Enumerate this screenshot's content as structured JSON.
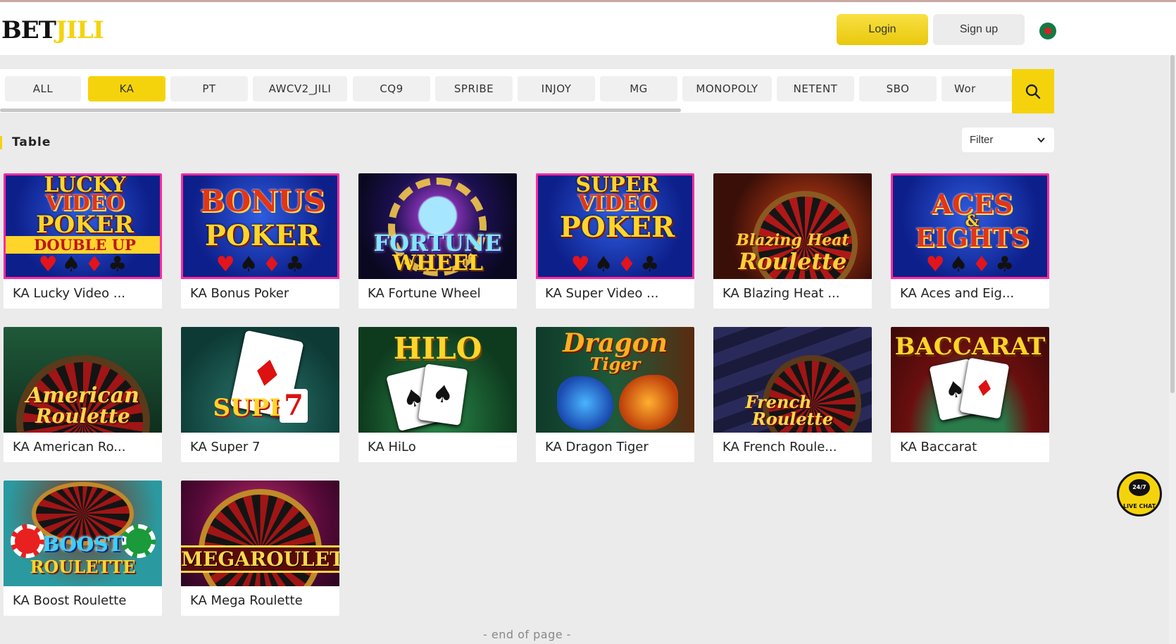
{
  "header": {
    "logo_part1": "BET",
    "logo_part2": "JILI",
    "login_label": "Login",
    "signup_label": "Sign up"
  },
  "providers": [
    "ALL",
    "KA",
    "PT",
    "AWCV2_JILI",
    "CQ9",
    "SPRIBE",
    "INJOY",
    "MG",
    "MONOPOLY",
    "NETENT",
    "SBO",
    "Wor"
  ],
  "active_provider": "KA",
  "section": {
    "title": "Table",
    "filter_label": "Filter"
  },
  "games": [
    {
      "name": "KA Lucky Video ...",
      "art": [
        "LUCKY",
        "VIDEO",
        "POKER",
        "DOUBLE UP"
      ]
    },
    {
      "name": "KA Bonus Poker",
      "art": [
        "BONUS",
        "POKER"
      ]
    },
    {
      "name": "KA Fortune Wheel",
      "art": [
        "FORTUNE",
        "WHEEL"
      ]
    },
    {
      "name": "KA Super Video ...",
      "art": [
        "SUPER",
        "VIDEO",
        "POKER"
      ]
    },
    {
      "name": "KA Blazing Heat ...",
      "art": [
        "Blazing Heat",
        "Roulette"
      ]
    },
    {
      "name": "KA Aces and Eig...",
      "art": [
        "ACES",
        "&",
        "EIGHTS"
      ]
    },
    {
      "name": "KA American Ro...",
      "art": [
        "American",
        "Roulette"
      ]
    },
    {
      "name": "KA Super 7",
      "art": [
        "SUPER",
        "7"
      ]
    },
    {
      "name": "KA HiLo",
      "art": [
        "HILO"
      ]
    },
    {
      "name": "KA Dragon Tiger",
      "art": [
        "Dragon",
        "Tiger"
      ]
    },
    {
      "name": "KA French Roule...",
      "art": [
        "French",
        "Roulette"
      ]
    },
    {
      "name": "KA Baccarat",
      "art": [
        "BACCARAT"
      ]
    },
    {
      "name": "KA Boost Roulette",
      "art": [
        "BOOST",
        "ROULETTE"
      ]
    },
    {
      "name": "KA Mega Roulette",
      "art": [
        "MEGAROULETTE"
      ]
    }
  ],
  "footer": {
    "end_text": "- end of page -"
  },
  "livechat": {
    "badge": "24/7",
    "label": "LIVE CHAT"
  },
  "colors": {
    "accent": "#f5d30c",
    "background": "#ebebeb"
  }
}
